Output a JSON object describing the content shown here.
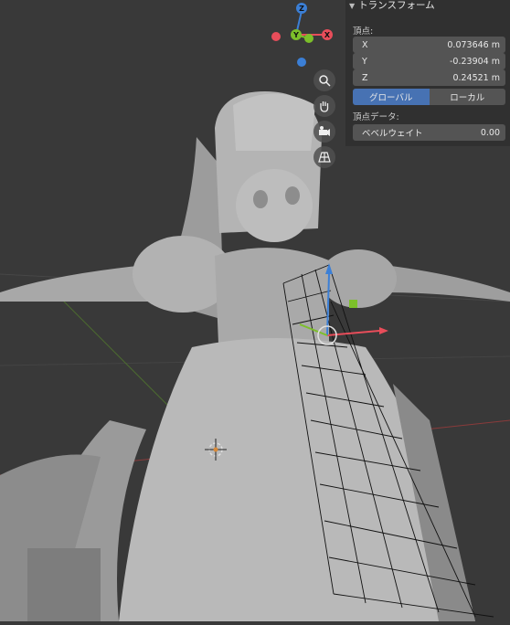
{
  "panel": {
    "header": "トランスフォーム",
    "vertex_label": "頂点:",
    "fields": [
      {
        "axis": "X",
        "value": "0.073646 m"
      },
      {
        "axis": "Y",
        "value": "-0.23904 m"
      },
      {
        "axis": "Z",
        "value": "0.24521 m"
      }
    ],
    "global_btn": "グローバル",
    "local_btn": "ローカル",
    "vertex_data_label": "頂点データ:",
    "bevel_weight_label": "ベベルウェイト",
    "bevel_weight_value": "0.00"
  },
  "gizmo": {
    "z": "Z",
    "y": "Y",
    "x": "X"
  },
  "colors": {
    "x_axis": "#e84d5a",
    "y_axis": "#7cbf2a",
    "z_axis": "#3b7fd6",
    "select": "#4772b3"
  },
  "icons": [
    "zoom-icon",
    "hand-pan-icon",
    "camera-icon",
    "grid-view-icon"
  ]
}
